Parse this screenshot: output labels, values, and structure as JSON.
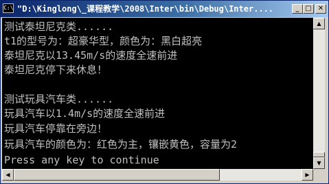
{
  "window": {
    "title": "\"D:\\Kinglong\\_课程教学\\2008\\Inter\\bin\\Debug\\Inter....",
    "icon": "console-icon",
    "icon_glyph": "C:\\",
    "buttons": {
      "minimize": "_",
      "maximize": "□",
      "close": "✕"
    }
  },
  "console": {
    "lines": [
      "测试泰坦尼克类......",
      "t1的型号为：超豪华型，颜色为：黑白超亮",
      "泰坦尼克以13.45m/s的速度全速前进",
      "泰坦尼克停下来休息！",
      "",
      "测试玩具汽车类......",
      "玩具汽车以1.4m/s的速度全速前进",
      "玩具汽车停靠在旁边！",
      "玩具汽车的颜色为：红色为主，镶嵌黄色，容量为2",
      "Press any key to continue"
    ]
  },
  "scrollbars": {
    "vertical": {
      "up": "▲",
      "down": "▼"
    },
    "horizontal": {
      "left": "◀",
      "right": "▶"
    }
  }
}
